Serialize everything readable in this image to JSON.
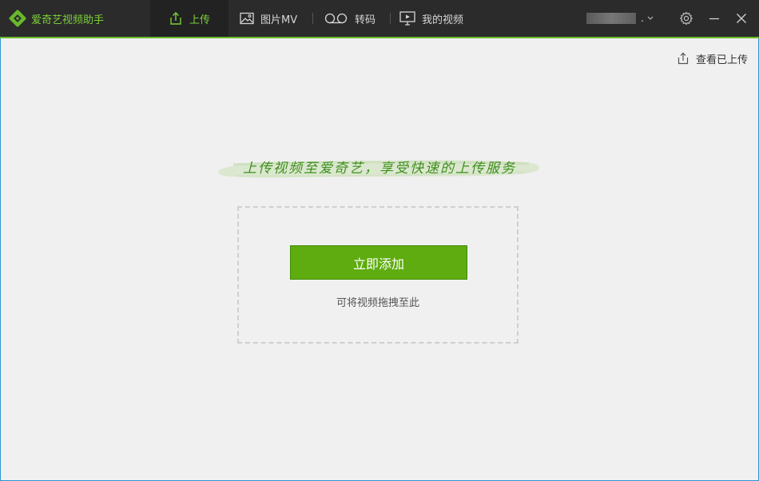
{
  "app": {
    "name": "爱奇艺视频助手"
  },
  "tabs": [
    {
      "label": "上传",
      "icon": "upload-icon",
      "active": true
    },
    {
      "label": "图片MV",
      "icon": "image-icon",
      "active": false
    },
    {
      "label": "转码",
      "icon": "transcode-icon",
      "active": false
    },
    {
      "label": "我的视频",
      "icon": "screen-icon",
      "active": false
    }
  ],
  "account": {
    "suffix": "."
  },
  "header": {
    "view_uploaded_label": "查看已上传"
  },
  "main": {
    "slogan": "上传视频至爱奇艺，享受快速的上传服务",
    "add_button_label": "立即添加",
    "drag_hint": "可将视频拖拽至此"
  },
  "colors": {
    "brand_green": "#7ccf3a",
    "button_green": "#5eac0f",
    "titlebar": "#2b2b2b",
    "background": "#f0f0f0"
  }
}
